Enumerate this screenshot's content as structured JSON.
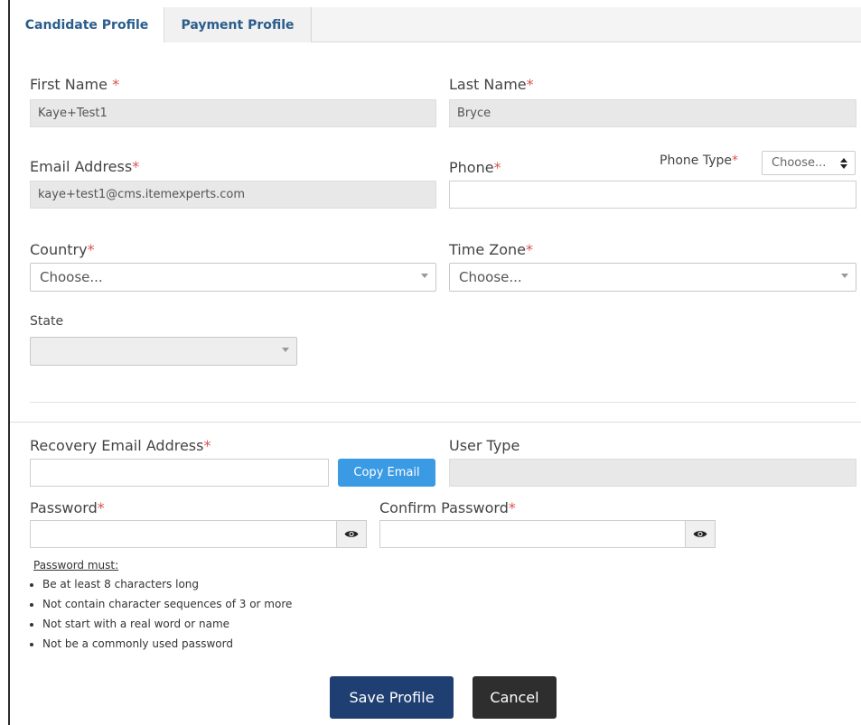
{
  "tabs": [
    {
      "label": "Candidate Profile",
      "active": true
    },
    {
      "label": "Payment Profile",
      "active": false
    }
  ],
  "form": {
    "first_name": {
      "label": "First Name",
      "required_mark": "*",
      "value": "Kaye+Test1"
    },
    "last_name": {
      "label": "Last Name",
      "required_mark": "*",
      "value": "Bryce"
    },
    "email": {
      "label": "Email Address",
      "required_mark": "*",
      "value": "kaye+test1@cms.itemexperts.com"
    },
    "phone": {
      "label": "Phone",
      "required_mark": "*",
      "value": ""
    },
    "phone_type": {
      "label": "Phone Type",
      "required_mark": "*",
      "selected": "Choose..."
    },
    "country": {
      "label": "Country",
      "required_mark": "*",
      "selected": "Choose..."
    },
    "time_zone": {
      "label": "Time Zone",
      "required_mark": "*",
      "selected": "Choose..."
    },
    "state": {
      "label": "State",
      "selected": ""
    },
    "recovery_email": {
      "label": "Recovery Email Address",
      "required_mark": "*",
      "value": ""
    },
    "copy_email_label": "Copy Email",
    "user_type": {
      "label": "User Type",
      "value": ""
    },
    "password": {
      "label": "Password",
      "required_mark": "*",
      "value": ""
    },
    "confirm_password": {
      "label": "Confirm Password",
      "required_mark": "*",
      "value": ""
    }
  },
  "password_rules": {
    "title": "Password must:",
    "items": [
      "Be at least 8 characters long",
      "Not contain character sequences of 3 or more",
      "Not start with a real word or name",
      "Not be a commonly used password"
    ]
  },
  "actions": {
    "save_label": "Save Profile",
    "cancel_label": "Cancel"
  },
  "colors": {
    "required": "#d9534f",
    "tab_text": "#2a5c8c",
    "copy_button": "#3b9ae4",
    "save_button": "#1f3f73",
    "cancel_button": "#2e2e2e"
  },
  "icons": {
    "password_toggle": "eye-icon",
    "select_caret": "caret-down-icon",
    "phone_type_caret": "sort-updown-icon"
  }
}
